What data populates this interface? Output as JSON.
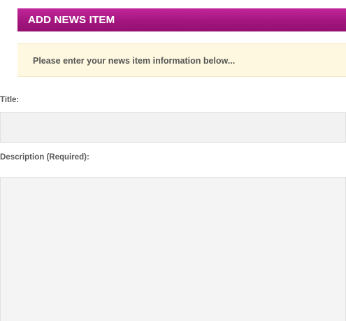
{
  "form": {
    "header_title": "ADD NEWS ITEM",
    "notice_text": "Please enter your news item information below...",
    "title_label": "Title:",
    "title_value": "",
    "title_placeholder": "",
    "description_label": "Description (Required):",
    "description_value": "",
    "description_placeholder": ""
  },
  "colors": {
    "header_background": "#a4157f",
    "header_text": "#ffffff",
    "notice_background": "#fdf8df",
    "input_background": "#f2f2f2"
  }
}
